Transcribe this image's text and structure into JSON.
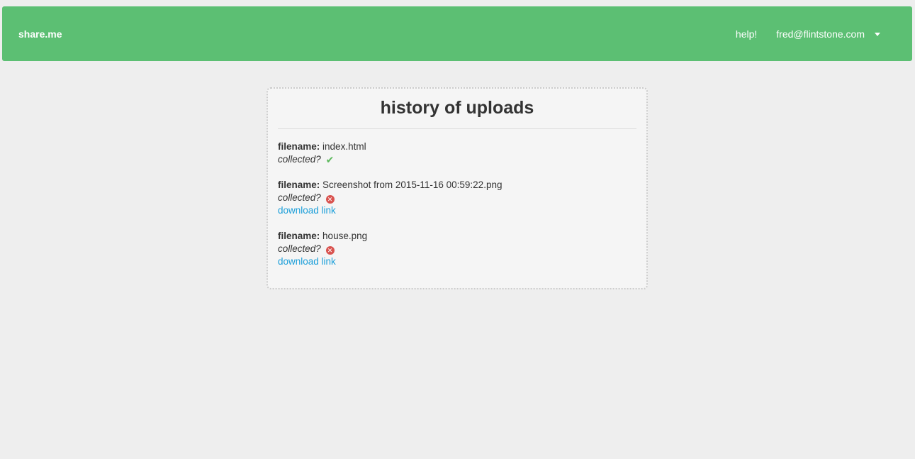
{
  "navbar": {
    "brand": "share.me",
    "help_label": "help!",
    "user_email": "fred@flintstone.com"
  },
  "main": {
    "title": "history of uploads",
    "filename_label": "filename:",
    "collected_label": "collected?",
    "uploads": [
      {
        "filename": "index.html",
        "collected": true,
        "collected_icon": "check-icon",
        "download_label": ""
      },
      {
        "filename": "Screenshot from 2015-11-16 00:59:22.png",
        "collected": false,
        "collected_icon": "x-circle-icon",
        "download_label": "download link"
      },
      {
        "filename": "house.png",
        "collected": false,
        "collected_icon": "x-circle-icon",
        "download_label": "download link"
      }
    ]
  },
  "colors": {
    "navbar_bg": "#5cbf73",
    "link": "#1a9ed9",
    "success": "#5cb85c",
    "danger": "#d9534f"
  }
}
